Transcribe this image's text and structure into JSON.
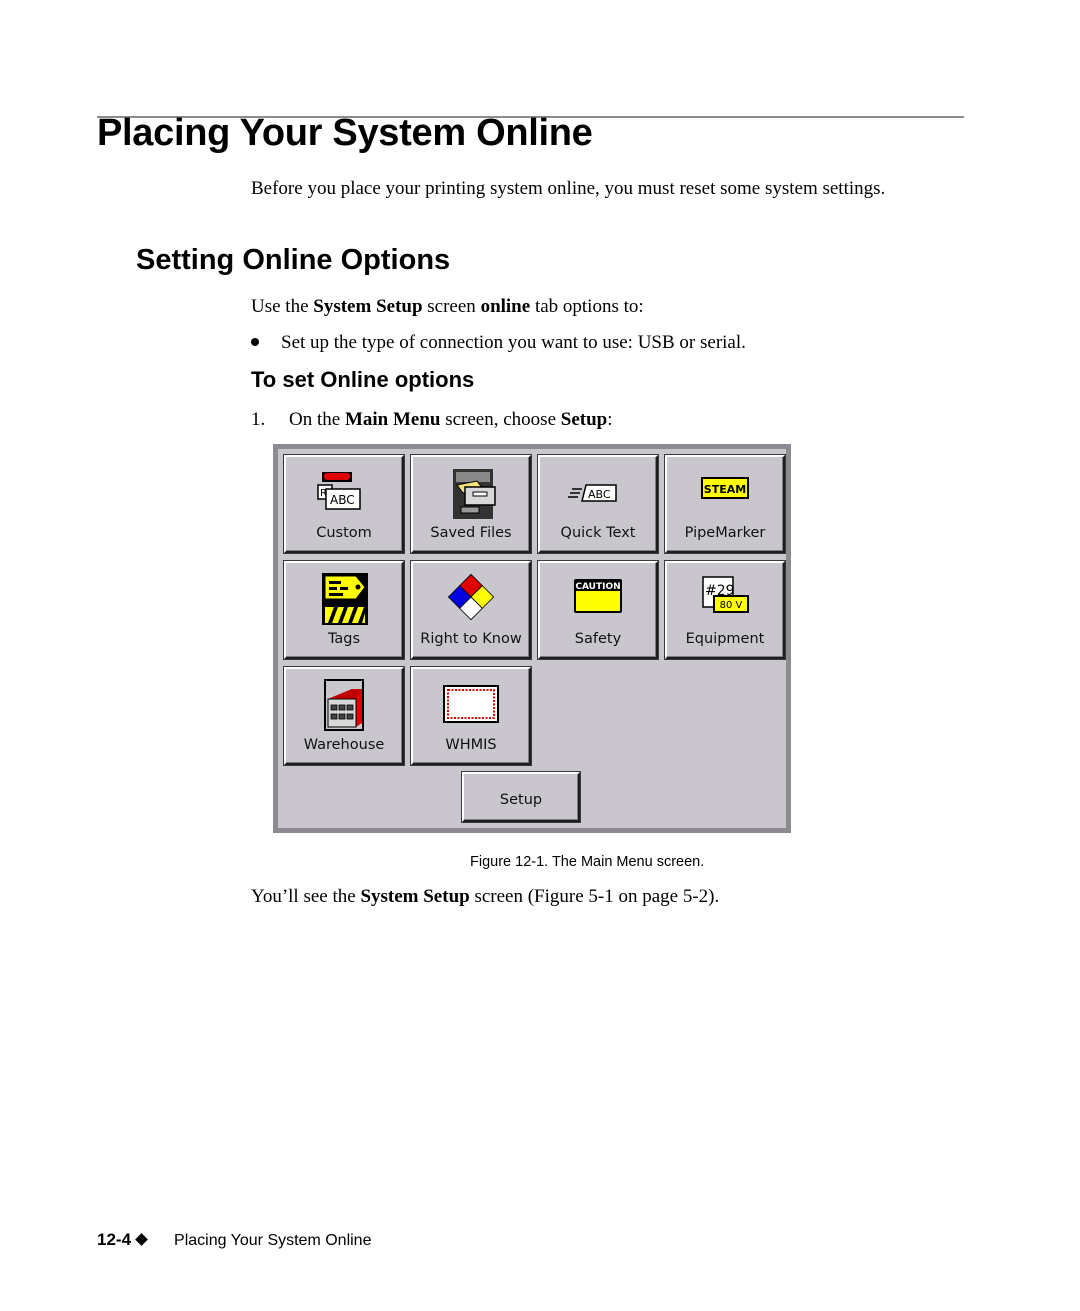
{
  "page": {
    "title": "Placing Your System Online",
    "intro": "Before you place your printing system online, you must reset some system settings.",
    "section": {
      "heading": "Setting Online Options",
      "para_parts": [
        "Use the ",
        "System Setup",
        " screen ",
        "online",
        " tab options to:"
      ],
      "bullets": [
        "Set up the type of connection you want to use: USB or serial."
      ],
      "subheading": "To set Online options",
      "step": {
        "number": "1.",
        "parts": [
          "On the ",
          "Main Menu",
          " screen, choose ",
          "Setup",
          ":"
        ]
      }
    },
    "figure": {
      "caption": "Figure 12-1. The Main Menu screen.",
      "buttons": [
        {
          "label": "Custom",
          "icon": "custom-label-icon"
        },
        {
          "label": "Saved Files",
          "icon": "file-cabinet-icon"
        },
        {
          "label": "Quick Text",
          "icon": "quick-text-icon"
        },
        {
          "label": "PipeMarker",
          "icon": "steam-pipemarker-icon",
          "icon_text": "STEAM"
        },
        {
          "label": "Tags",
          "icon": "tag-icon"
        },
        {
          "label": "Right to Know",
          "icon": "nfpa-diamond-icon"
        },
        {
          "label": "Safety",
          "icon": "caution-sign-icon",
          "icon_text": "CAUTION"
        },
        {
          "label": "Equipment",
          "icon": "equipment-label-icon",
          "icon_text": [
            "#29",
            "80 V"
          ]
        },
        {
          "label": "Warehouse",
          "icon": "warehouse-icon"
        },
        {
          "label": "WHMIS",
          "icon": "whmis-border-icon"
        }
      ],
      "setup_label": "Setup",
      "colors": {
        "panel": "#c9c6ce",
        "frame": "#8d8b91",
        "red": "#e00000",
        "yellow": "#ffff00",
        "blue": "#0000e0"
      }
    },
    "after_parts": [
      "You’ll see the ",
      "System Setup",
      " screen (Figure 5-1 on page 5-2)."
    ],
    "footer": {
      "page_number": "12-4",
      "chapter_title": "Placing Your System Online"
    }
  }
}
